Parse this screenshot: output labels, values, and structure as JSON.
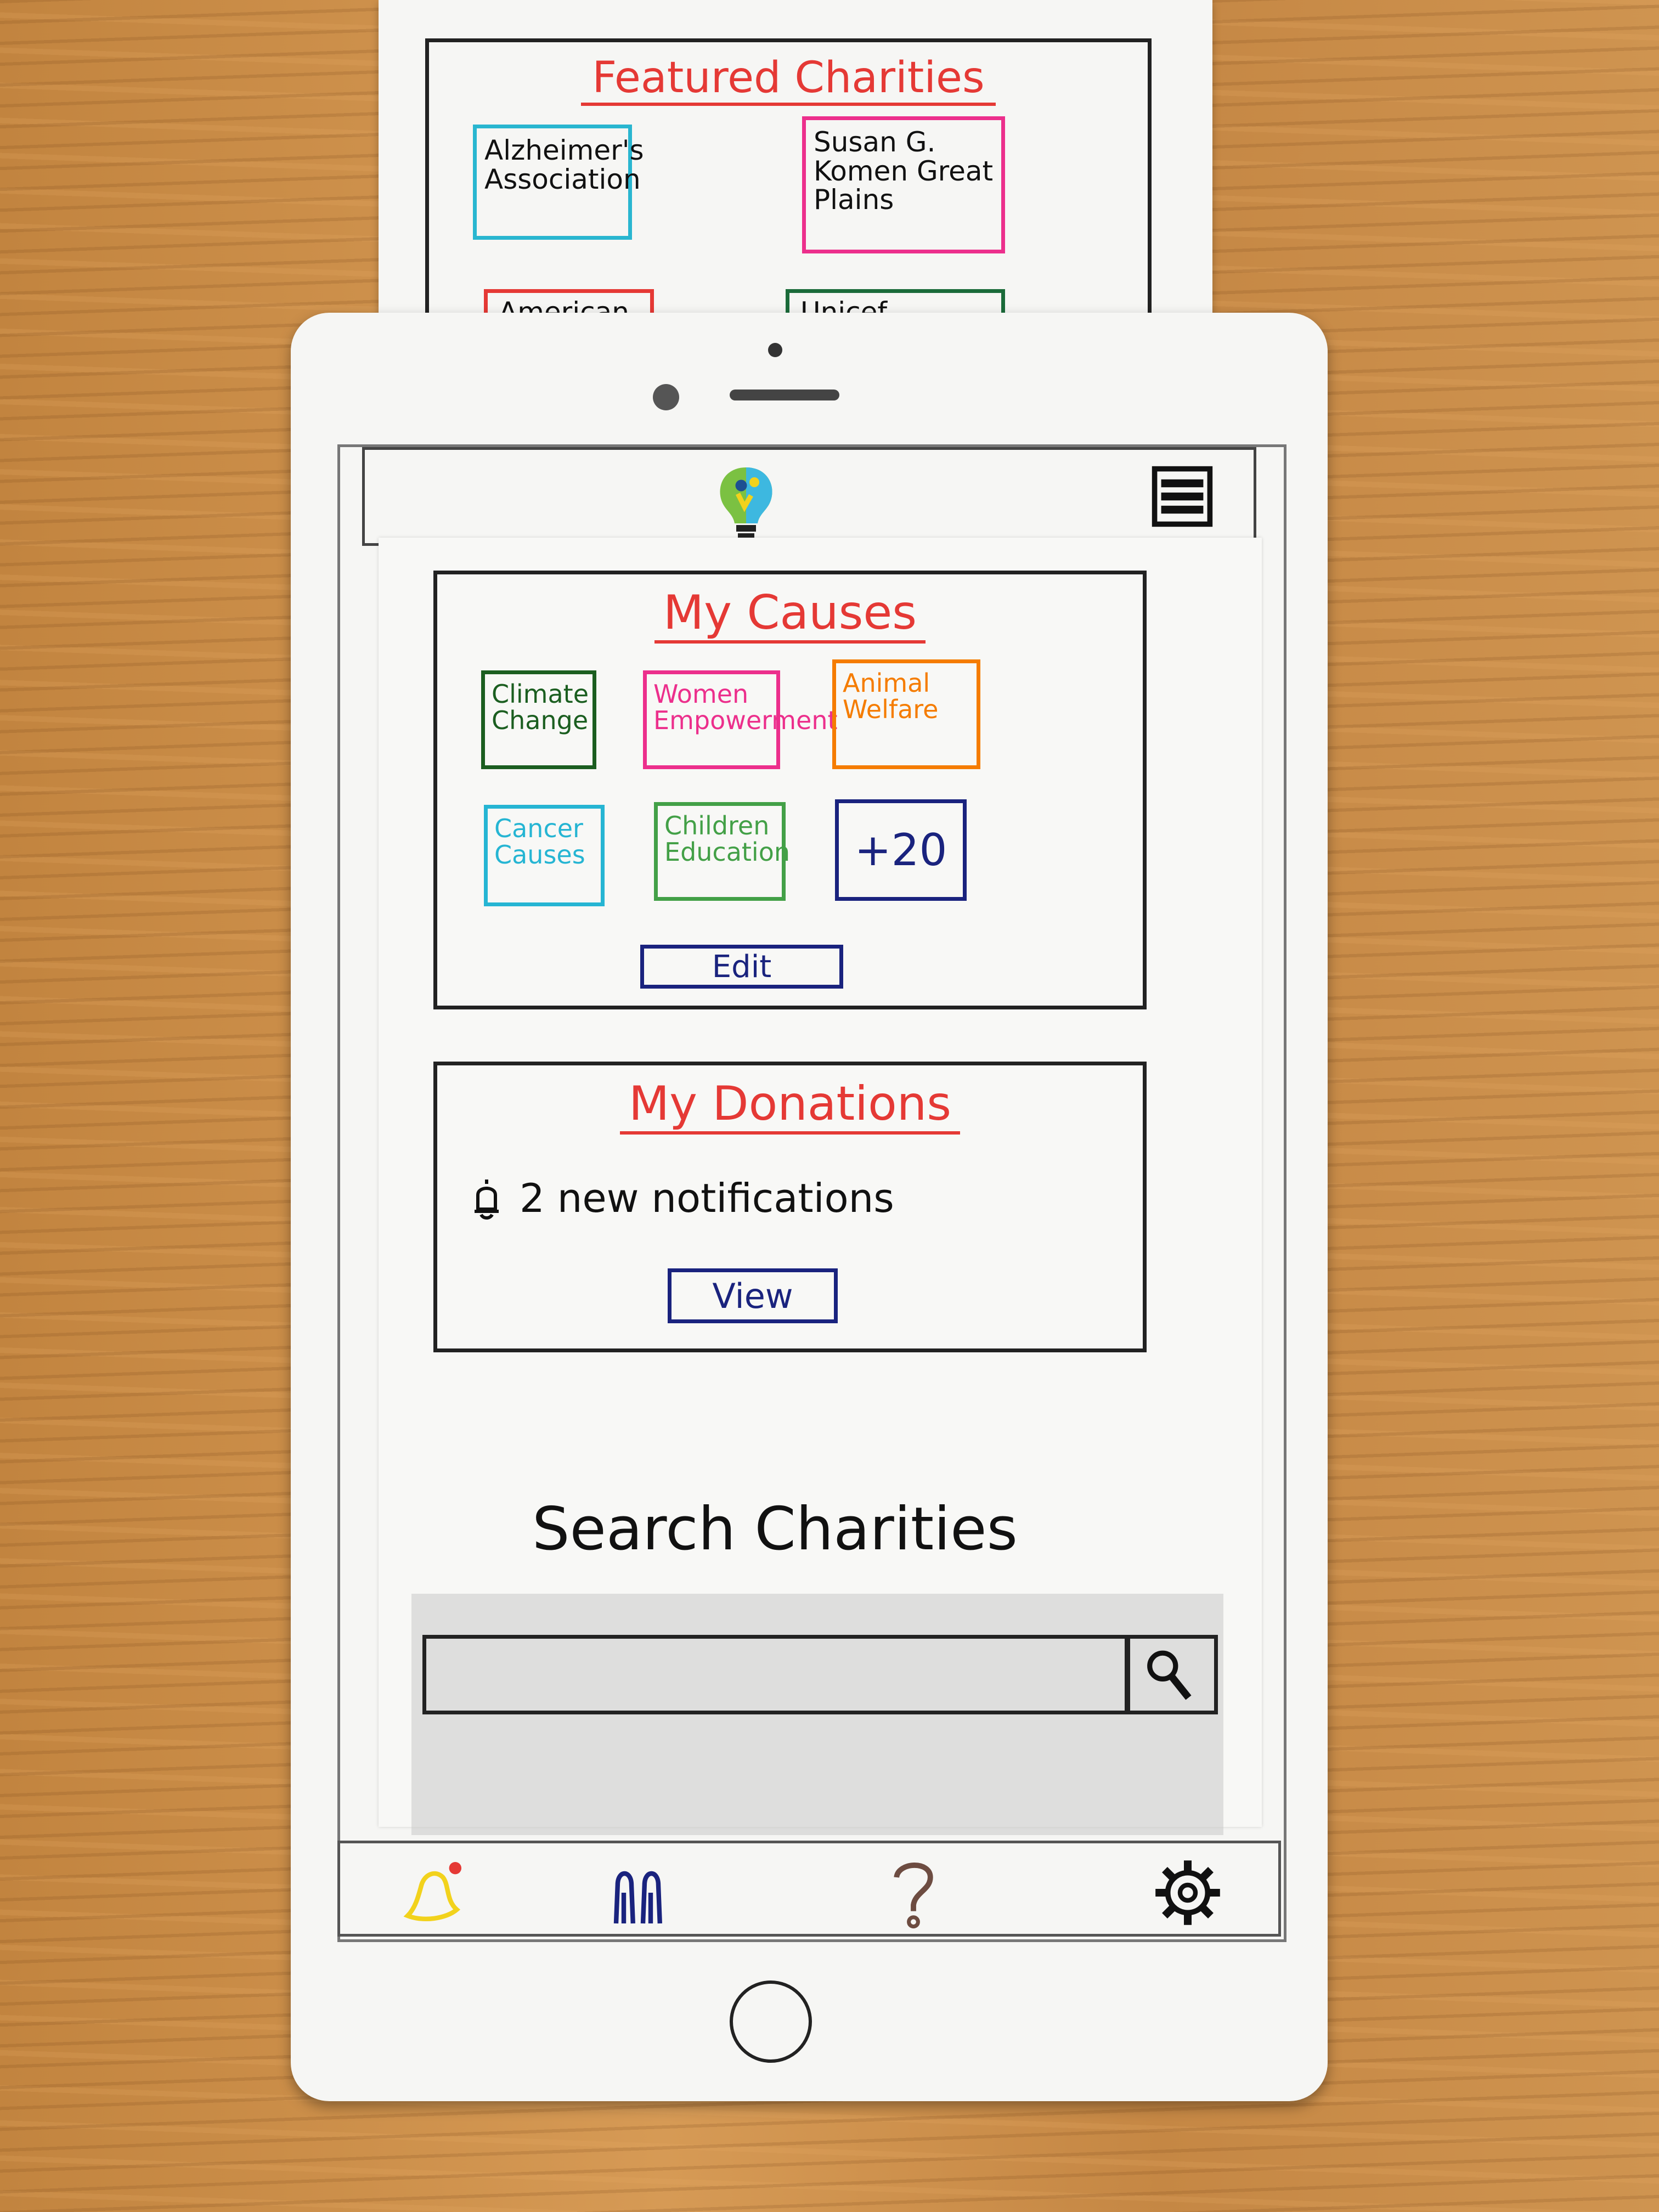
{
  "featured": {
    "title": "Featured Charities",
    "charities": [
      {
        "name": "Alzheimer's Association",
        "color": "#29b6d0"
      },
      {
        "name": "Susan G. Komen Great Plains",
        "color": "#ec2f8c"
      },
      {
        "name": "American",
        "color": "#e53935"
      },
      {
        "name": "Unicef",
        "color": "#1b6b3a"
      }
    ]
  },
  "header": {
    "logo_icon": "lightbulb-people-logo-icon",
    "menu_icon": "hamburger-menu-icon"
  },
  "causes": {
    "title": "My Causes",
    "items": [
      {
        "label": "Climate Change",
        "color": "#1b5e20"
      },
      {
        "label": "Women Empowerment",
        "color": "#ec2f8c"
      },
      {
        "label": "Animal Welfare",
        "color": "#f57c00"
      },
      {
        "label": "Cancer Causes",
        "color": "#26b5d3"
      },
      {
        "label": "Children Education",
        "color": "#43a047"
      },
      {
        "label": "+20",
        "color": "#1a237e"
      }
    ],
    "edit_label": "Edit"
  },
  "donations": {
    "title": "My Donations",
    "notification_text": "2 new notifications",
    "view_label": "View"
  },
  "search": {
    "title": "Search Charities",
    "placeholder": ""
  },
  "tabbar": {
    "items": [
      {
        "icon": "bell-icon",
        "color": "#f2d21c"
      },
      {
        "icon": "people-icon",
        "color": "#1a237e"
      },
      {
        "icon": "question-icon",
        "color": "#6d4c41"
      },
      {
        "icon": "gear-icon",
        "color": "#111111"
      }
    ]
  }
}
